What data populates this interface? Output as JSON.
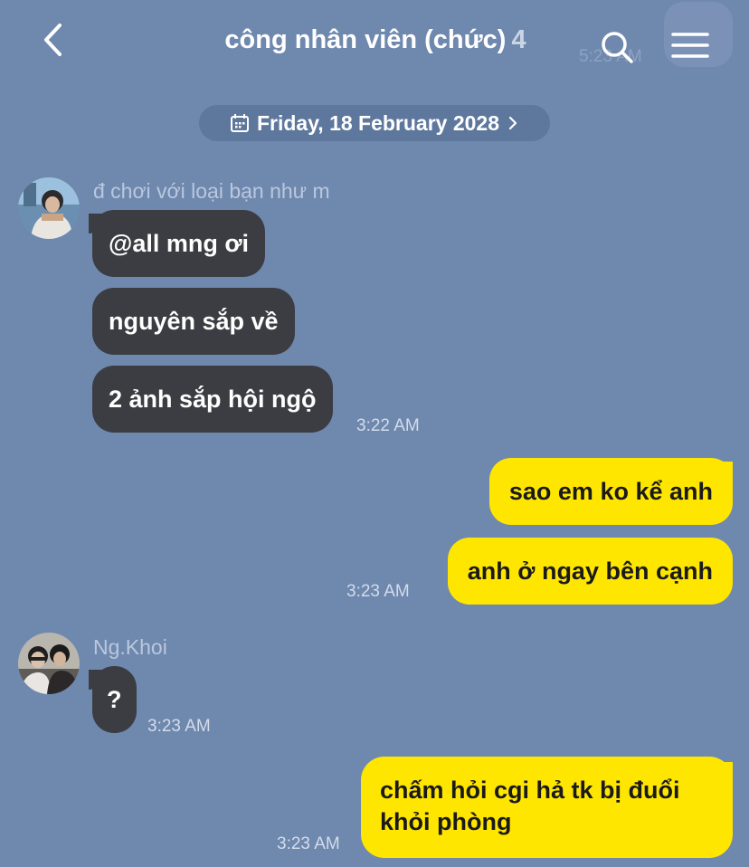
{
  "header": {
    "title": "công nhân viên (chức)",
    "member_count": "4",
    "ghost_time": "5:23 AM"
  },
  "date_divider": {
    "label": "Friday, 18 February 2028"
  },
  "colors": {
    "background": "#6f88ae",
    "incoming_bubble": "#3b3d42",
    "outgoing_bubble": "#ffe600"
  },
  "messages": [
    {
      "sender": "đ chơi với loại bạn như m",
      "bubbles": [
        "@all mng ơi",
        "nguyên sắp về",
        "2 ảnh sắp hội ngộ"
      ],
      "time": "3:22 AM"
    },
    {
      "sender": "me",
      "bubbles": [
        "sao em ko kể anh",
        "anh ở ngay bên cạnh"
      ],
      "time": "3:23 AM"
    },
    {
      "sender": "Ng.Khoi",
      "bubbles": [
        "?"
      ],
      "time": "3:23 AM"
    },
    {
      "sender": "me",
      "bubbles": [
        "chấm hỏi cgi hả tk bị đuổi khỏi phòng"
      ],
      "lines": [
        "chấm hỏi cgi hả tk bị đuổi",
        "khỏi phòng"
      ],
      "time": "3:23 AM"
    }
  ]
}
